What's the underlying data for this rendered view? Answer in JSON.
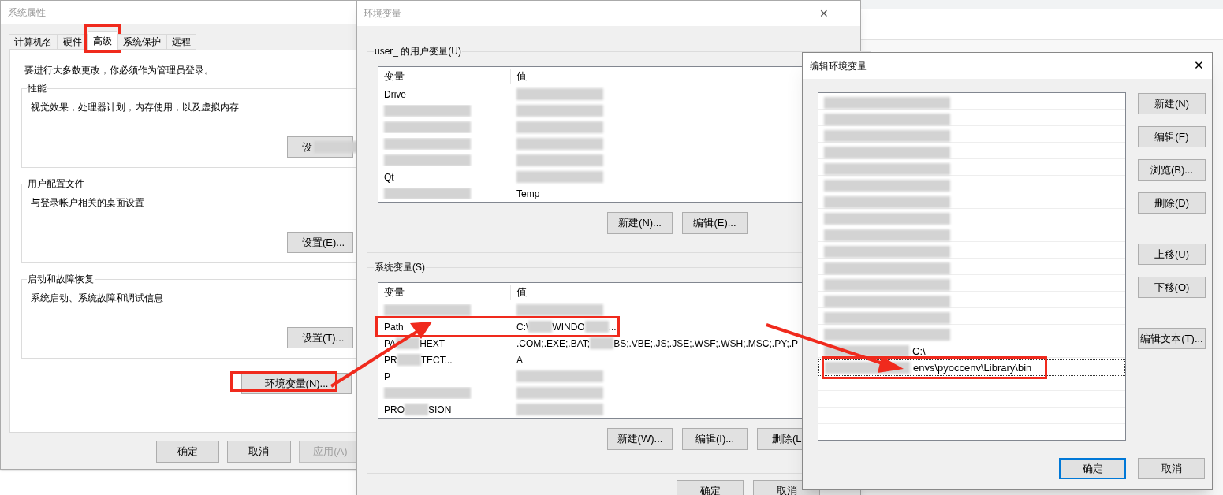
{
  "system_properties": {
    "title": "系统属性",
    "tabs": [
      {
        "label": "计算机名",
        "selected": false,
        "annotated": false
      },
      {
        "label": "硬件",
        "selected": false,
        "annotated": false
      },
      {
        "label": "高级",
        "selected": true,
        "annotated": true
      },
      {
        "label": "系统保护",
        "selected": false,
        "annotated": false
      },
      {
        "label": "远程",
        "selected": false,
        "annotated": false
      }
    ],
    "notice": "要进行大多数更改，你必须作为管理员登录。",
    "groups": [
      {
        "title": "性能",
        "description": "视觉效果，处理器计划，内存使用，以及虚拟内存",
        "button": "设",
        "button_blurred": true
      },
      {
        "title": "用户配置文件",
        "description": "与登录帐户相关的桌面设置",
        "button": "设置(E)...",
        "button_blurred": false
      },
      {
        "title": "启动和故障恢复",
        "description": "系统启动、系统故障和调试信息",
        "button": "设置(T)...",
        "button_blurred": false
      }
    ],
    "env_button": {
      "label": "环境变量(N)...",
      "annotated": true
    },
    "footer_buttons": [
      {
        "label": "确定",
        "disabled": false
      },
      {
        "label": "取消",
        "disabled": false
      },
      {
        "label": "应用(A)",
        "disabled": true
      }
    ]
  },
  "environment_variables": {
    "title": "环境变量",
    "user_section": {
      "label": "user_ 的用户变量(U)",
      "columns": [
        "变量",
        "值"
      ],
      "rows": [
        {
          "name": [
            "Drive"
          ],
          "blurred": true
        },
        {
          "blurred": true
        },
        {
          "blurred": true
        },
        {
          "blurred": true
        },
        {
          "blurred": true
        },
        {
          "name": [
            "Qt"
          ],
          "blurred": true
        },
        {
          "value": [
            "Temp"
          ],
          "blurred": true
        }
      ],
      "buttons": [
        "新建(N)...",
        "编辑(E)..."
      ]
    },
    "system_section": {
      "label": "系统变量(S)",
      "columns": [
        "变量",
        "值"
      ],
      "rows": [
        {
          "blurred": true
        },
        {
          "name": [
            "Path"
          ],
          "value": [
            "C:\\",
            "WINDO",
            "..."
          ],
          "blurred": true,
          "annotated": true
        },
        {
          "name": [
            "PA",
            "HEXT"
          ],
          "value": [
            ".COM;.EXE;.BAT;",
            "BS;.VBE;.JS;.JSE;.WSF;.WSH;.MSC;.PY;.P"
          ],
          "blurred": true
        },
        {
          "name": [
            "PR",
            "TECT..."
          ],
          "value": [
            "A"
          ],
          "blurred": true
        },
        {
          "name": [
            "P"
          ],
          "blurred": true
        },
        {
          "blurred": true
        },
        {
          "name": [
            "PRO",
            "SION"
          ],
          "blurred": true
        }
      ],
      "buttons": [
        "新建(W)...",
        "编辑(I)...",
        "删除(L"
      ]
    },
    "footer_buttons": [
      "确定",
      "取消"
    ]
  },
  "edit_variable": {
    "title": "编辑环境变量",
    "close": "✕",
    "entries": [
      {
        "blurred": true
      },
      {
        "blurred": true
      },
      {
        "blurred": true
      },
      {
        "blurred": true
      },
      {
        "blurred": true
      },
      {
        "blurred": true
      },
      {
        "blurred": true
      },
      {
        "blurred": true
      },
      {
        "blurred": true
      },
      {
        "blurred": true
      },
      {
        "blurred": true
      },
      {
        "blurred": true
      },
      {
        "blurred": true
      },
      {
        "blurred": true
      },
      {
        "blurred": true
      },
      {
        "text": [
          "C:\\"
        ],
        "blurred": true,
        "selected": false
      },
      {
        "text": [
          "envs\\pyoccenv\\Library\\bin"
        ],
        "blurred": true,
        "selected": true,
        "annotated": true
      }
    ],
    "button_groups": [
      [
        "新建(N)",
        "编辑(E)",
        "浏览(B)...",
        "删除(D)"
      ],
      [
        "上移(U)",
        "下移(O)"
      ],
      [
        "编辑文本(T)..."
      ]
    ],
    "footer_buttons": [
      {
        "label": "确定",
        "default": true
      },
      {
        "label": "取消",
        "default": false
      }
    ]
  }
}
